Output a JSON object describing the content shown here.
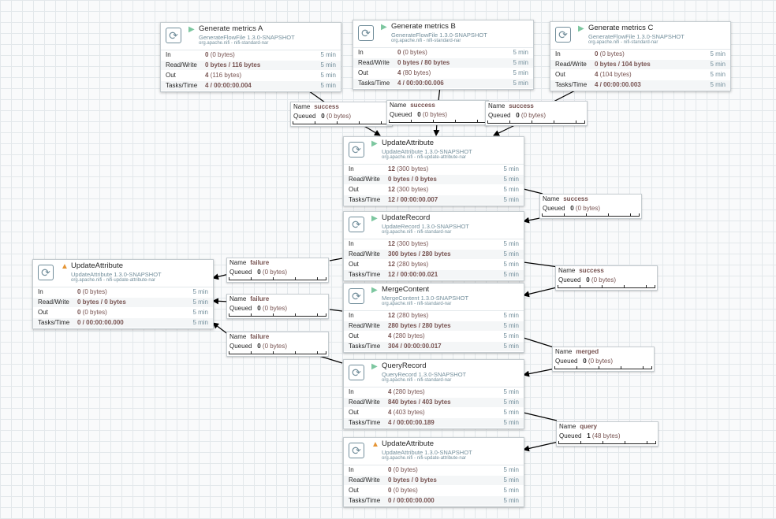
{
  "canvas": {
    "processors": [
      {
        "id": "genA",
        "name": "Generate metrics A",
        "type": "GenerateFlowFile 1.3.0-SNAPSHOT",
        "bundle": "org.apache.nifi - nifi-standard-nar",
        "state": "running",
        "stats": [
          {
            "label": "In",
            "value": "0",
            "detail": " (0 bytes)",
            "time": "5 min"
          },
          {
            "label": "Read/Write",
            "value": "0 bytes / 116 bytes",
            "detail": "",
            "time": "5 min"
          },
          {
            "label": "Out",
            "value": "4",
            "detail": " (116 bytes)",
            "time": "5 min"
          },
          {
            "label": "Tasks/Time",
            "value": "4 / 00:00:00.004",
            "detail": "",
            "time": "5 min"
          }
        ]
      },
      {
        "id": "genB",
        "name": "Generate metrics B",
        "type": "GenerateFlowFile 1.3.0-SNAPSHOT",
        "bundle": "org.apache.nifi - nifi-standard-nar",
        "state": "running",
        "stats": [
          {
            "label": "In",
            "value": "0",
            "detail": " (0 bytes)",
            "time": "5 min"
          },
          {
            "label": "Read/Write",
            "value": "0 bytes / 80 bytes",
            "detail": "",
            "time": "5 min"
          },
          {
            "label": "Out",
            "value": "4",
            "detail": " (80 bytes)",
            "time": "5 min"
          },
          {
            "label": "Tasks/Time",
            "value": "4 / 00:00:00.006",
            "detail": "",
            "time": "5 min"
          }
        ]
      },
      {
        "id": "genC",
        "name": "Generate metrics C",
        "type": "GenerateFlowFile 1.3.0-SNAPSHOT",
        "bundle": "org.apache.nifi - nifi-standard-nar",
        "state": "running",
        "stats": [
          {
            "label": "In",
            "value": "0",
            "detail": " (0 bytes)",
            "time": "5 min"
          },
          {
            "label": "Read/Write",
            "value": "0 bytes / 104 bytes",
            "detail": "",
            "time": "5 min"
          },
          {
            "label": "Out",
            "value": "4",
            "detail": " (104 bytes)",
            "time": "5 min"
          },
          {
            "label": "Tasks/Time",
            "value": "4 / 00:00:00.003",
            "detail": "",
            "time": "5 min"
          }
        ]
      },
      {
        "id": "upd1",
        "name": "UpdateAttribute",
        "type": "UpdateAttribute 1.3.0-SNAPSHOT",
        "bundle": "org.apache.nifi - nifi-update-attribute-nar",
        "state": "running",
        "stats": [
          {
            "label": "In",
            "value": "12",
            "detail": " (300 bytes)",
            "time": "5 min"
          },
          {
            "label": "Read/Write",
            "value": "0 bytes / 0 bytes",
            "detail": "",
            "time": "5 min"
          },
          {
            "label": "Out",
            "value": "12",
            "detail": " (300 bytes)",
            "time": "5 min"
          },
          {
            "label": "Tasks/Time",
            "value": "12 / 00:00:00.007",
            "detail": "",
            "time": "5 min"
          }
        ]
      },
      {
        "id": "updRec",
        "name": "UpdateRecord",
        "type": "UpdateRecord 1.3.0-SNAPSHOT",
        "bundle": "org.apache.nifi - nifi-standard-nar",
        "state": "running",
        "stats": [
          {
            "label": "In",
            "value": "12",
            "detail": " (300 bytes)",
            "time": "5 min"
          },
          {
            "label": "Read/Write",
            "value": "300 bytes / 280 bytes",
            "detail": "",
            "time": "5 min"
          },
          {
            "label": "Out",
            "value": "12",
            "detail": " (280 bytes)",
            "time": "5 min"
          },
          {
            "label": "Tasks/Time",
            "value": "12 / 00:00:00.021",
            "detail": "",
            "time": "5 min"
          }
        ]
      },
      {
        "id": "merge",
        "name": "MergeContent",
        "type": "MergeContent 1.3.0-SNAPSHOT",
        "bundle": "org.apache.nifi - nifi-standard-nar",
        "state": "running",
        "stats": [
          {
            "label": "In",
            "value": "12",
            "detail": " (280 bytes)",
            "time": "5 min"
          },
          {
            "label": "Read/Write",
            "value": "280 bytes / 280 bytes",
            "detail": "",
            "time": "5 min"
          },
          {
            "label": "Out",
            "value": "4",
            "detail": " (280 bytes)",
            "time": "5 min"
          },
          {
            "label": "Tasks/Time",
            "value": "304 / 00:00:00.017",
            "detail": "",
            "time": "5 min"
          }
        ]
      },
      {
        "id": "query",
        "name": "QueryRecord",
        "type": "QueryRecord 1.3.0-SNAPSHOT",
        "bundle": "org.apache.nifi - nifi-standard-nar",
        "state": "running",
        "stats": [
          {
            "label": "In",
            "value": "4",
            "detail": " (280 bytes)",
            "time": "5 min"
          },
          {
            "label": "Read/Write",
            "value": "840 bytes / 403 bytes",
            "detail": "",
            "time": "5 min"
          },
          {
            "label": "Out",
            "value": "4",
            "detail": " (403 bytes)",
            "time": "5 min"
          },
          {
            "label": "Tasks/Time",
            "value": "4 / 00:00:00.189",
            "detail": "",
            "time": "5 min"
          }
        ]
      },
      {
        "id": "updFail",
        "name": "UpdateAttribute",
        "type": "UpdateAttribute 1.3.0-SNAPSHOT",
        "bundle": "org.apache.nifi - nifi-update-attribute-nar",
        "state": "invalid",
        "stats": [
          {
            "label": "In",
            "value": "0",
            "detail": " (0 bytes)",
            "time": "5 min"
          },
          {
            "label": "Read/Write",
            "value": "0 bytes / 0 bytes",
            "detail": "",
            "time": "5 min"
          },
          {
            "label": "Out",
            "value": "0",
            "detail": " (0 bytes)",
            "time": "5 min"
          },
          {
            "label": "Tasks/Time",
            "value": "0 / 00:00:00.000",
            "detail": "",
            "time": "5 min"
          }
        ]
      },
      {
        "id": "updEnd",
        "name": "UpdateAttribute",
        "type": "UpdateAttribute 1.3.0-SNAPSHOT",
        "bundle": "org.apache.nifi - nifi-update-attribute-nar",
        "state": "invalid",
        "stats": [
          {
            "label": "In",
            "value": "0",
            "detail": " (0 bytes)",
            "time": "5 min"
          },
          {
            "label": "Read/Write",
            "value": "0 bytes / 0 bytes",
            "detail": "",
            "time": "5 min"
          },
          {
            "label": "Out",
            "value": "0",
            "detail": " (0 bytes)",
            "time": "5 min"
          },
          {
            "label": "Tasks/Time",
            "value": "0 / 00:00:00.000",
            "detail": "",
            "time": "5 min"
          }
        ]
      }
    ],
    "connections": [
      {
        "id": "cA",
        "name_label": "Name",
        "name": "success",
        "queued_label": "Queued",
        "queued_count": "0",
        "queued_bytes": "(0 bytes)"
      },
      {
        "id": "cB",
        "name_label": "Name",
        "name": "success",
        "queued_label": "Queued",
        "queued_count": "0",
        "queued_bytes": "(0 bytes)"
      },
      {
        "id": "cC",
        "name_label": "Name",
        "name": "success",
        "queued_label": "Queued",
        "queued_count": "0",
        "queued_bytes": "(0 bytes)"
      },
      {
        "id": "cUpd",
        "name_label": "Name",
        "name": "success",
        "queued_label": "Queued",
        "queued_count": "0",
        "queued_bytes": "(0 bytes)"
      },
      {
        "id": "cUR",
        "name_label": "Name",
        "name": "success",
        "queued_label": "Queued",
        "queued_count": "0",
        "queued_bytes": "(0 bytes)"
      },
      {
        "id": "cF1",
        "name_label": "Name",
        "name": "failure",
        "queued_label": "Queued",
        "queued_count": "0",
        "queued_bytes": "(0 bytes)"
      },
      {
        "id": "cF2",
        "name_label": "Name",
        "name": "failure",
        "queued_label": "Queued",
        "queued_count": "0",
        "queued_bytes": "(0 bytes)"
      },
      {
        "id": "cF3",
        "name_label": "Name",
        "name": "failure",
        "queued_label": "Queued",
        "queued_count": "0",
        "queued_bytes": "(0 bytes)"
      },
      {
        "id": "cM",
        "name_label": "Name",
        "name": "merged",
        "queued_label": "Queued",
        "queued_count": "0",
        "queued_bytes": "(0 bytes)"
      },
      {
        "id": "cQ",
        "name_label": "Name",
        "name": "query",
        "queued_label": "Queued",
        "queued_count": "1",
        "queued_bytes": "(48 bytes)"
      }
    ]
  },
  "colors": {
    "canvas": "#f9fafb",
    "grid": "#e3e8eb",
    "running": "#7dc7a0",
    "invalid": "#e59535",
    "value": "#775351",
    "meta": "#728e9b"
  },
  "icons": {
    "processor": "refresh-icon",
    "running": "play-icon",
    "invalid": "warning-icon"
  }
}
